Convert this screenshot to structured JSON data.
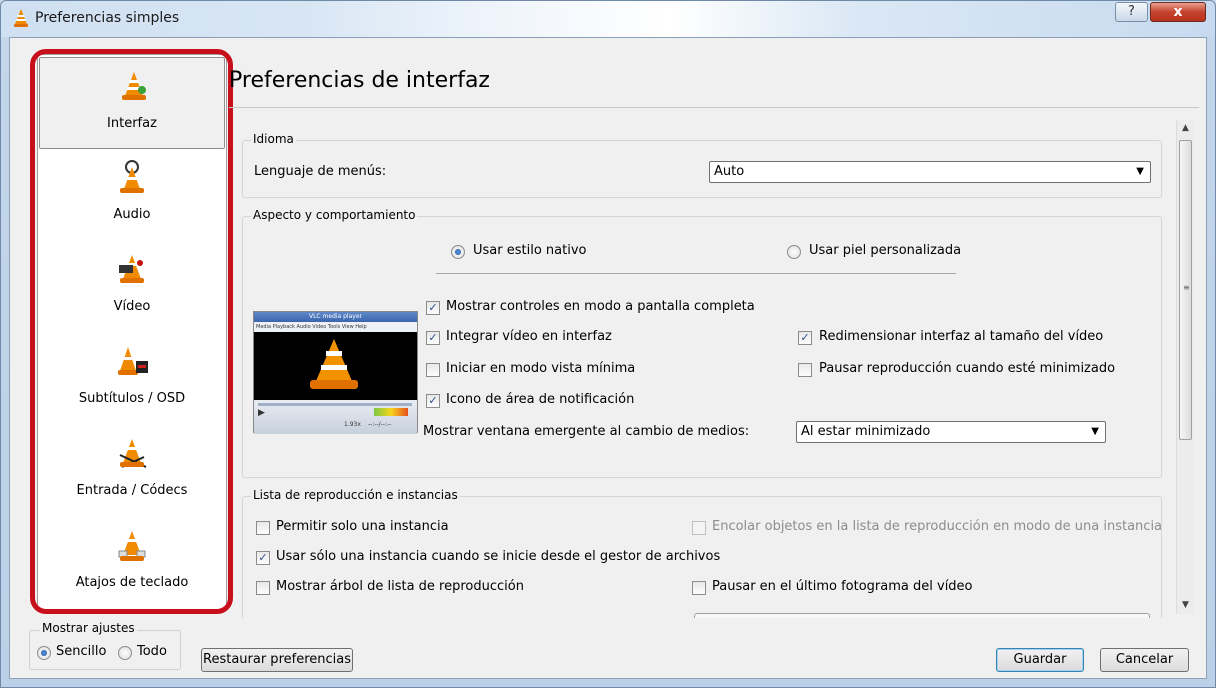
{
  "window": {
    "title": "Preferencias simples",
    "help_glyph": "?",
    "close_glyph": "x"
  },
  "sidebar": {
    "items": [
      {
        "label": "Interfaz",
        "icon": "interface-cone-icon",
        "selected": true
      },
      {
        "label": "Audio",
        "icon": "audio-cone-icon",
        "selected": false
      },
      {
        "label": "Vídeo",
        "icon": "video-cone-icon",
        "selected": false
      },
      {
        "label": "Subtítulos / OSD",
        "icon": "subtitles-cone-icon",
        "selected": false
      },
      {
        "label": "Entrada / Códecs",
        "icon": "input-codecs-cone-icon",
        "selected": false
      },
      {
        "label": "Atajos de teclado",
        "icon": "hotkeys-cone-icon",
        "selected": false
      }
    ]
  },
  "main": {
    "title": "Preferencias de interfaz",
    "idioma": {
      "title": "Idioma",
      "menu_lang_label": "Lenguaje de menús:",
      "menu_lang_value": "Auto"
    },
    "aspecto": {
      "title": "Aspecto y comportamiento",
      "native_style": "Usar estilo nativo",
      "custom_skin": "Usar piel personalizada",
      "fullscreen_controls": "Mostrar controles en modo a pantalla completa",
      "embed_video": "Integrar vídeo en interfaz",
      "resize_to_video": "Redimensionar interfaz al tamaño del vídeo",
      "start_minimal": "Iniciar en modo vista mínima",
      "pause_minimized": "Pausar reproducción cuando esté minimizado",
      "systray_icon": "Icono de área de notificación",
      "popup_label": "Mostrar ventana emergente al cambio de medios:",
      "popup_value": "Al estar minimizado",
      "preview_title": "VLC media player",
      "preview_menu": "Media  Playback  Audio  Video  Tools  View  Help",
      "preview_time": "1.93x",
      "preview_time2": "--:--/--:--"
    },
    "playlist": {
      "title": "Lista de reproducción e instancias",
      "one_instance": "Permitir solo una instancia",
      "enqueue": "Encolar objetos en la lista de reproducción en modo de una instancia",
      "one_instance_fm": "Usar sólo una instancia cuando se inicie desde el gestor de archivos",
      "show_tree": "Mostrar árbol de lista de reproducción",
      "pause_last_frame": "Pausar en el último fotograma del vídeo"
    }
  },
  "footer": {
    "show_settings": "Mostrar ajustes",
    "simple": "Sencillo",
    "all": "Todo",
    "reset": "Restaurar preferencias",
    "save": "Guardar",
    "cancel": "Cancelar"
  },
  "colors": {
    "highlight_outline": "#c8101c",
    "cone_orange": "#f08a00",
    "check_blue": "#2b4d8c"
  }
}
